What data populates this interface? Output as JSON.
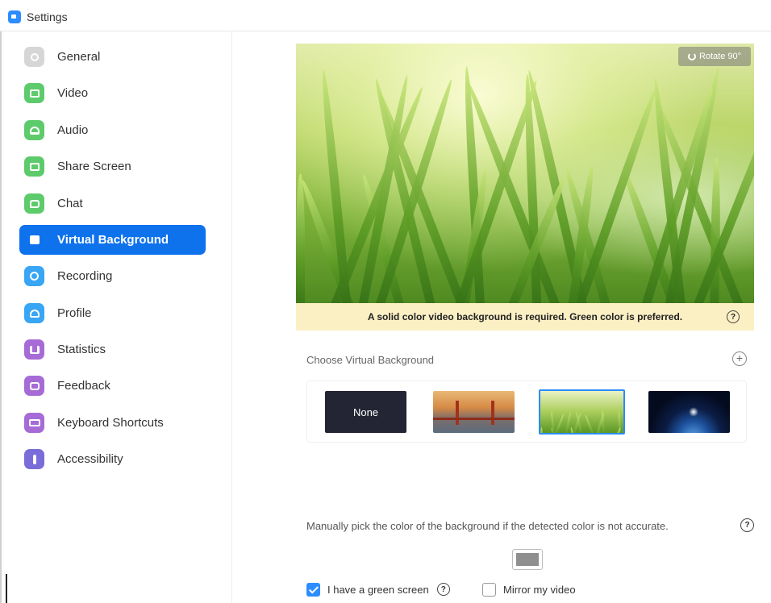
{
  "window": {
    "title": "Settings"
  },
  "sidebar": {
    "items": [
      {
        "label": "General",
        "color": "#cfcfcf",
        "icon": "gear-icon"
      },
      {
        "label": "Video",
        "color": "#5dcb6b",
        "icon": "video-camera-icon"
      },
      {
        "label": "Audio",
        "color": "#5dcb6b",
        "icon": "headphones-icon"
      },
      {
        "label": "Share Screen",
        "color": "#5dcb6b",
        "icon": "share-screen-icon"
      },
      {
        "label": "Chat",
        "color": "#5dcb6b",
        "icon": "chat-bubble-icon"
      },
      {
        "label": "Virtual Background",
        "color": "#ffffff",
        "icon": "person-background-icon",
        "active": true
      },
      {
        "label": "Recording",
        "color": "#38a5f5",
        "icon": "record-icon"
      },
      {
        "label": "Profile",
        "color": "#38a5f5",
        "icon": "profile-icon"
      },
      {
        "label": "Statistics",
        "color": "#a66bd7",
        "icon": "bar-chart-icon"
      },
      {
        "label": "Feedback",
        "color": "#a66bd7",
        "icon": "feedback-icon"
      },
      {
        "label": "Keyboard Shortcuts",
        "color": "#a66bd7",
        "icon": "keyboard-icon"
      },
      {
        "label": "Accessibility",
        "color": "#7a6cd9",
        "icon": "accessibility-icon"
      }
    ]
  },
  "preview": {
    "rotate_label": "Rotate 90°",
    "notice": "A solid color video background is required. Green color is preferred.",
    "help_glyph": "?"
  },
  "choose": {
    "label": "Choose Virtual Background",
    "add_glyph": "+",
    "thumbnails": [
      {
        "label": "None"
      },
      {
        "label": "",
        "kind": "bridge"
      },
      {
        "label": "",
        "kind": "grass",
        "selected": true
      },
      {
        "label": "",
        "kind": "earth"
      }
    ]
  },
  "manual": {
    "text": "Manually pick the color of the background if the detected color is not accurate.",
    "help_glyph": "?",
    "swatch_color": "#8f8f8f"
  },
  "options": {
    "green_screen_label": "I have a green screen",
    "green_screen_checked": true,
    "mirror_label": "Mirror my video",
    "mirror_checked": false,
    "help_glyph": "?"
  },
  "colors": {
    "accent": "#0e72ed",
    "checkbox": "#2d8cff",
    "notice_bg": "#fbefc4"
  }
}
